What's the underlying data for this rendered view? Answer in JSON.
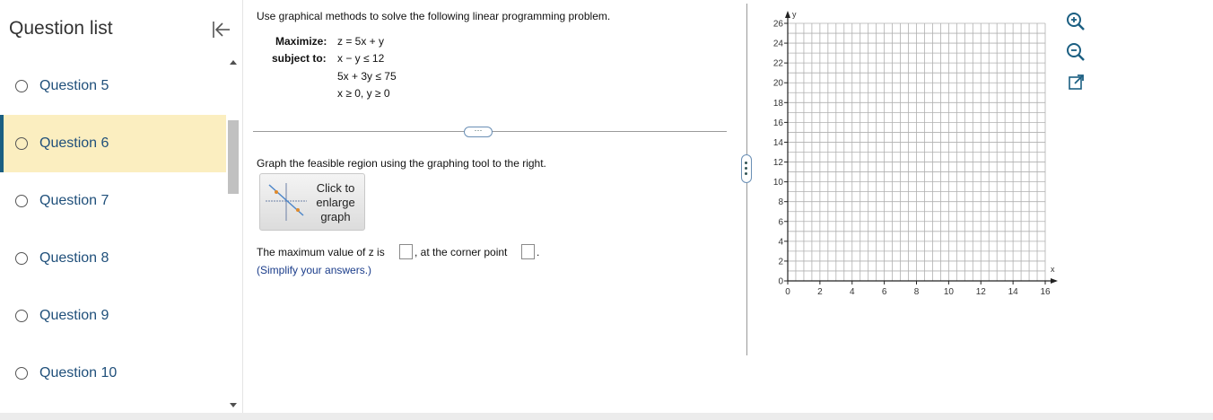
{
  "sidebar": {
    "title": "Question list",
    "items": [
      {
        "label": "Question 5",
        "active": false
      },
      {
        "label": "Question 6",
        "active": true
      },
      {
        "label": "Question 7",
        "active": false
      },
      {
        "label": "Question 8",
        "active": false
      },
      {
        "label": "Question 9",
        "active": false
      },
      {
        "label": "Question 10",
        "active": false
      }
    ]
  },
  "problem": {
    "intro": "Use graphical methods to solve the following linear programming problem.",
    "maximize_label": "Maximize:",
    "objective": "z = 5x + y",
    "subject_label": "subject to:",
    "constraint1": "x − y ≤ 12",
    "constraint2": "5x + 3y ≤ 75",
    "constraint3": "x ≥ 0, y ≥ 0",
    "instruction": "Graph the feasible region using the graphing tool to the right.",
    "enlarge_line1": "Click to",
    "enlarge_line2": "enlarge",
    "enlarge_line3": "graph",
    "answer_prefix": "The maximum value of z is",
    "answer_middle": ", at the corner point",
    "answer_end": ".",
    "simplify_note": "(Simplify your answers.)"
  },
  "graph": {
    "x_axis_label": "x",
    "y_axis_label": "y",
    "x_ticks": [
      "0",
      "2",
      "4",
      "6",
      "8",
      "10",
      "12",
      "14",
      "16"
    ],
    "y_ticks": [
      "0",
      "2",
      "4",
      "6",
      "8",
      "10",
      "12",
      "14",
      "16",
      "18",
      "20",
      "22",
      "24",
      "26"
    ],
    "x_range": [
      0,
      16
    ],
    "y_range": [
      0,
      26
    ],
    "grid": true
  },
  "tools": [
    "zoom-in-icon",
    "zoom-out-icon",
    "popout-icon"
  ],
  "colors": {
    "active_bg": "#fbeec0",
    "active_bar": "#1b5f82",
    "link": "#1f4f7a"
  }
}
